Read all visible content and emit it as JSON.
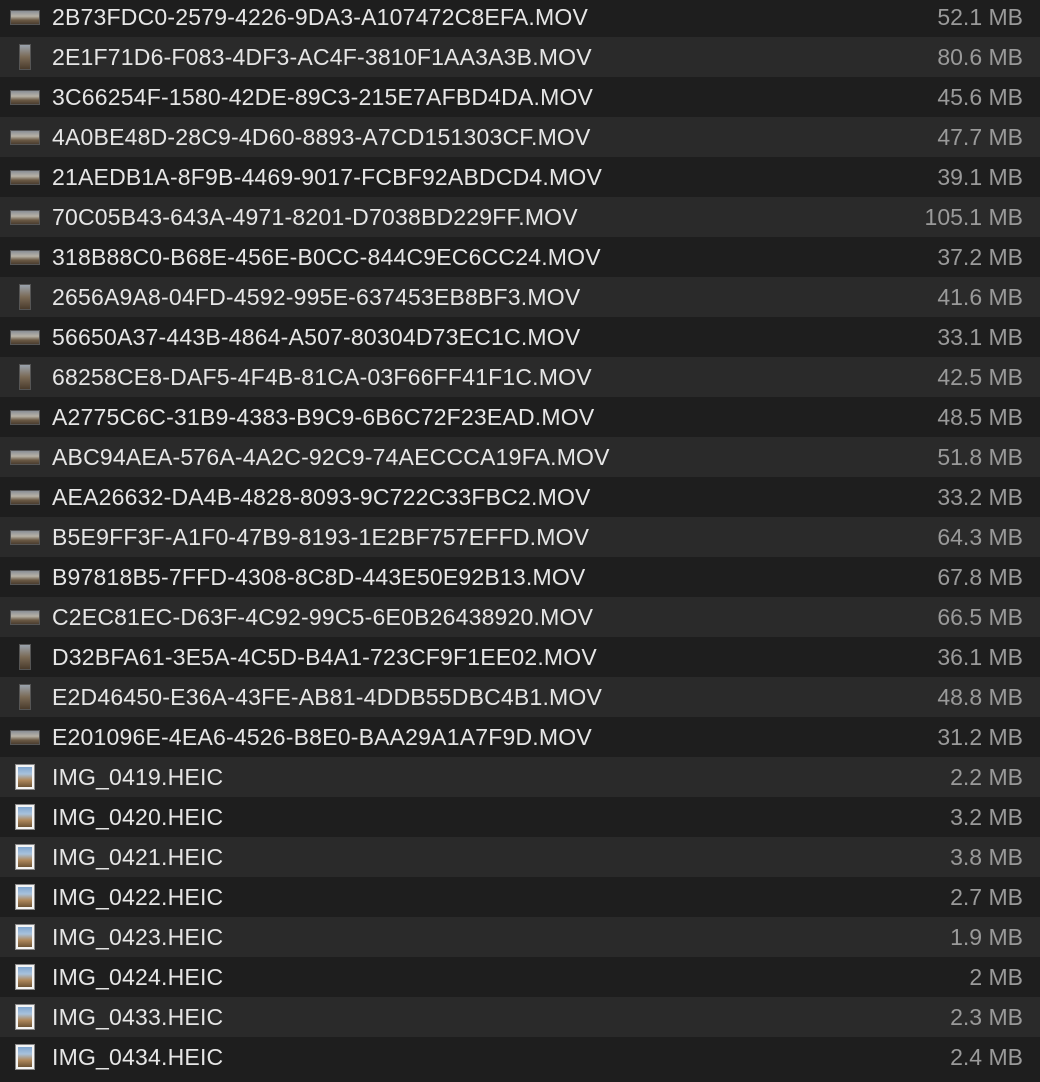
{
  "files": [
    {
      "name": "2B73FDC0-2579-4226-9DA3-A107472C8EFA.MOV",
      "size": "52.1 MB",
      "thumb": "landscape"
    },
    {
      "name": "2E1F71D6-F083-4DF3-AC4F-3810F1AA3A3B.MOV",
      "size": "80.6 MB",
      "thumb": "portrait"
    },
    {
      "name": "3C66254F-1580-42DE-89C3-215E7AFBD4DA.MOV",
      "size": "45.6 MB",
      "thumb": "landscape"
    },
    {
      "name": "4A0BE48D-28C9-4D60-8893-A7CD151303CF.MOV",
      "size": "47.7 MB",
      "thumb": "landscape"
    },
    {
      "name": "21AEDB1A-8F9B-4469-9017-FCBF92ABDCD4.MOV",
      "size": "39.1 MB",
      "thumb": "landscape"
    },
    {
      "name": "70C05B43-643A-4971-8201-D7038BD229FF.MOV",
      "size": "105.1 MB",
      "thumb": "landscape"
    },
    {
      "name": "318B88C0-B68E-456E-B0CC-844C9EC6CC24.MOV",
      "size": "37.2 MB",
      "thumb": "landscape"
    },
    {
      "name": "2656A9A8-04FD-4592-995E-637453EB8BF3.MOV",
      "size": "41.6 MB",
      "thumb": "portrait"
    },
    {
      "name": "56650A37-443B-4864-A507-80304D73EC1C.MOV",
      "size": "33.1 MB",
      "thumb": "landscape"
    },
    {
      "name": "68258CE8-DAF5-4F4B-81CA-03F66FF41F1C.MOV",
      "size": "42.5 MB",
      "thumb": "portrait"
    },
    {
      "name": "A2775C6C-31B9-4383-B9C9-6B6C72F23EAD.MOV",
      "size": "48.5 MB",
      "thumb": "landscape"
    },
    {
      "name": "ABC94AEA-576A-4A2C-92C9-74AECCCA19FA.MOV",
      "size": "51.8 MB",
      "thumb": "landscape"
    },
    {
      "name": "AEA26632-DA4B-4828-8093-9C722C33FBC2.MOV",
      "size": "33.2 MB",
      "thumb": "landscape"
    },
    {
      "name": "B5E9FF3F-A1F0-47B9-8193-1E2BF757EFFD.MOV",
      "size": "64.3 MB",
      "thumb": "landscape"
    },
    {
      "name": "B97818B5-7FFD-4308-8C8D-443E50E92B13.MOV",
      "size": "67.8 MB",
      "thumb": "landscape"
    },
    {
      "name": "C2EC81EC-D63F-4C92-99C5-6E0B26438920.MOV",
      "size": "66.5 MB",
      "thumb": "landscape"
    },
    {
      "name": "D32BFA61-3E5A-4C5D-B4A1-723CF9F1EE02.MOV",
      "size": "36.1 MB",
      "thumb": "portrait"
    },
    {
      "name": "E2D46450-E36A-43FE-AB81-4DDB55DBC4B1.MOV",
      "size": "48.8 MB",
      "thumb": "portrait"
    },
    {
      "name": "E201096E-4EA6-4526-B8E0-BAA29A1A7F9D.MOV",
      "size": "31.2 MB",
      "thumb": "landscape"
    },
    {
      "name": "IMG_0419.HEIC",
      "size": "2.2 MB",
      "thumb": "photo"
    },
    {
      "name": "IMG_0420.HEIC",
      "size": "3.2 MB",
      "thumb": "photo"
    },
    {
      "name": "IMG_0421.HEIC",
      "size": "3.8 MB",
      "thumb": "photo"
    },
    {
      "name": "IMG_0422.HEIC",
      "size": "2.7 MB",
      "thumb": "photo"
    },
    {
      "name": "IMG_0423.HEIC",
      "size": "1.9 MB",
      "thumb": "photo"
    },
    {
      "name": "IMG_0424.HEIC",
      "size": "2 MB",
      "thumb": "photo"
    },
    {
      "name": "IMG_0433.HEIC",
      "size": "2.3 MB",
      "thumb": "photo"
    },
    {
      "name": "IMG_0434.HEIC",
      "size": "2.4 MB",
      "thumb": "photo"
    }
  ]
}
